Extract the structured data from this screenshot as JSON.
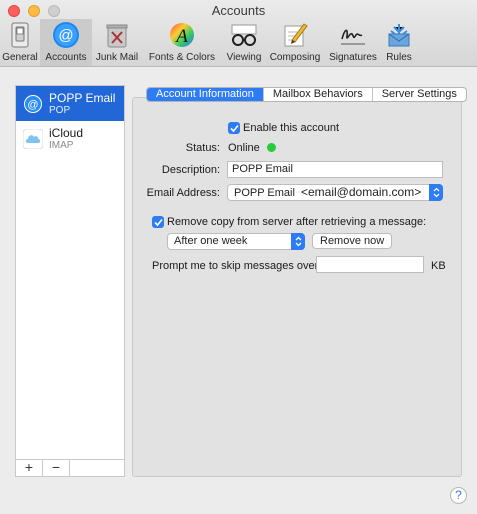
{
  "window": {
    "title": "Accounts"
  },
  "toolbar": {
    "items": [
      {
        "label": "General",
        "icon": "general-switch-icon"
      },
      {
        "label": "Accounts",
        "icon": "at-sign-icon"
      },
      {
        "label": "Junk Mail",
        "icon": "trash-can-icon"
      },
      {
        "label": "Fonts & Colors",
        "icon": "font-palette-icon"
      },
      {
        "label": "Viewing",
        "icon": "glasses-icon"
      },
      {
        "label": "Composing",
        "icon": "pencil-paper-icon"
      },
      {
        "label": "Signatures",
        "icon": "signature-icon"
      },
      {
        "label": "Rules",
        "icon": "rules-envelope-icon"
      }
    ],
    "active": "Accounts"
  },
  "accounts": [
    {
      "name": "POPP Email",
      "type": "POP",
      "icon": "at-sign-icon",
      "selected": true
    },
    {
      "name": "iCloud",
      "type": "IMAP",
      "icon": "cloud-icon",
      "selected": false
    }
  ],
  "list_footer": {
    "add": "+",
    "remove": "−"
  },
  "tabs": [
    {
      "label": "Account Information",
      "active": true
    },
    {
      "label": "Mailbox Behaviors",
      "active": false
    },
    {
      "label": "Server Settings",
      "active": false
    }
  ],
  "form": {
    "enable_label": "Enable this account",
    "enable_checked": true,
    "status_label": "Status:",
    "status_value": "Online",
    "status_color": "#29c940",
    "description_label": "Description:",
    "description_value": "POPP Email",
    "email_label": "Email Address:",
    "email_name": "POPP Email",
    "email_address": "<email@domain.com>",
    "remove_copy_label": "Remove copy from server after retrieving a message:",
    "remove_copy_checked": true,
    "remove_period": "After one week",
    "remove_now_label": "Remove now",
    "prompt_label": "Prompt me to skip messages over",
    "prompt_value": "",
    "prompt_unit": "KB"
  },
  "help": {
    "label": "?"
  },
  "colors": {
    "accent": "#2d7cf6",
    "selection": "#2267d8"
  }
}
